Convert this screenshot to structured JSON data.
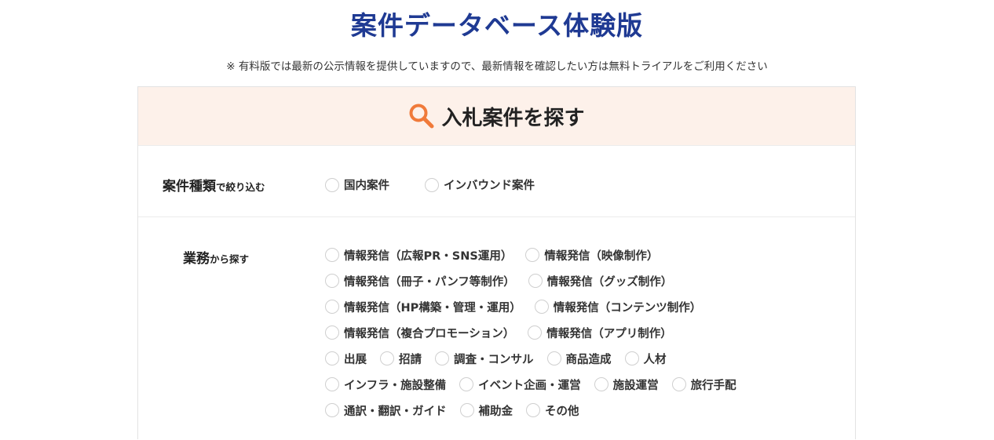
{
  "page": {
    "title": "案件データベース体験版",
    "notice": "※ 有料版では最新の公示情報を提供していますので、最新情報を確認したい方は無料トライアルをご利用ください"
  },
  "panel": {
    "heading": "入札案件を探す",
    "heading_icon": "search-icon",
    "accent_color": "#f07a3a",
    "head_bg": "#fdf1ea",
    "title_color": "#1f3a93"
  },
  "case_type": {
    "label_main": "案件種類",
    "label_sub": "で絞り込む",
    "options": [
      "国内案件",
      "インバウンド案件"
    ]
  },
  "work": {
    "label_main": "業務",
    "label_sub": "から探す",
    "rows": [
      [
        "情報発信（広報PR・SNS運用）",
        "情報発信（映像制作）"
      ],
      [
        "情報発信（冊子・パンフ等制作）",
        "情報発信（グッズ制作）"
      ],
      [
        "情報発信（HP構築・管理・運用）",
        "情報発信（コンテンツ制作）"
      ],
      [
        "情報発信（複合プロモーション）",
        "情報発信（アプリ制作）"
      ],
      [
        "出展",
        "招請",
        "調査・コンサル",
        "商品造成",
        "人材"
      ],
      [
        "インフラ・施設整備",
        "イベント企画・運営",
        "施設運営",
        "旅行手配"
      ],
      [
        "通訳・翻訳・ガイド",
        "補助金",
        "その他"
      ]
    ]
  }
}
